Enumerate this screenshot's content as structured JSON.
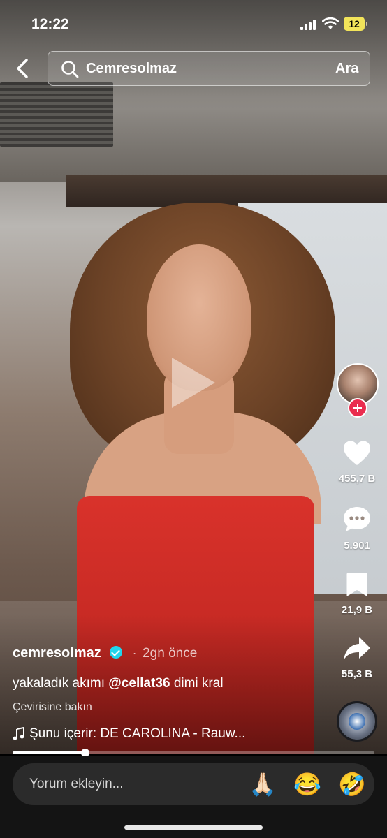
{
  "status_bar": {
    "time": "12:22",
    "battery": "12"
  },
  "search": {
    "query": "Cemresolmaz",
    "button": "Ara"
  },
  "rail": {
    "likes": "455,7 B",
    "comments": "5.901",
    "saves": "21,9 B",
    "shares": "55,3 B"
  },
  "post": {
    "username": "cemresolmaz",
    "time_ago": "2gn önce",
    "caption_prefix": "yakaladık akımı",
    "mention": "@cellat36",
    "caption_suffix": "dimi kral",
    "translate": "Çevirisine bakın",
    "music": "Şunu içerir: DE CAROLINA - Rauw..."
  },
  "playback": {
    "progress": 0.2
  },
  "comment_bar": {
    "placeholder": "Yorum ekleyin...",
    "emojis": [
      "🙏🏻",
      "😂",
      "🤣"
    ]
  },
  "colors": {
    "accent": "#ea2d4f",
    "verified": "#20d5ec",
    "dress": "#d9322b"
  }
}
